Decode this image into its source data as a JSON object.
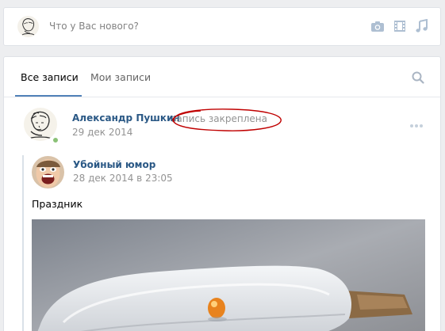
{
  "composer": {
    "placeholder": "Что у Вас нового?",
    "icons": [
      "camera-icon",
      "video-icon",
      "music-icon"
    ]
  },
  "tabs": [
    {
      "label": "Все записи",
      "active": true
    },
    {
      "label": "Мои записи",
      "active": false
    }
  ],
  "post": {
    "author": "Александр Пушкин",
    "pinned_label": "запись закреплена",
    "date": "29 дек 2014",
    "online": true,
    "repost": {
      "source": "Убойный юмор",
      "date": "28 дек 2014 в 23:05",
      "text": "Праздник"
    }
  },
  "colors": {
    "link": "#2a5885",
    "accent": "#5181b8",
    "muted": "#939393",
    "annotation": "#c00000",
    "background": "#edeef0"
  }
}
